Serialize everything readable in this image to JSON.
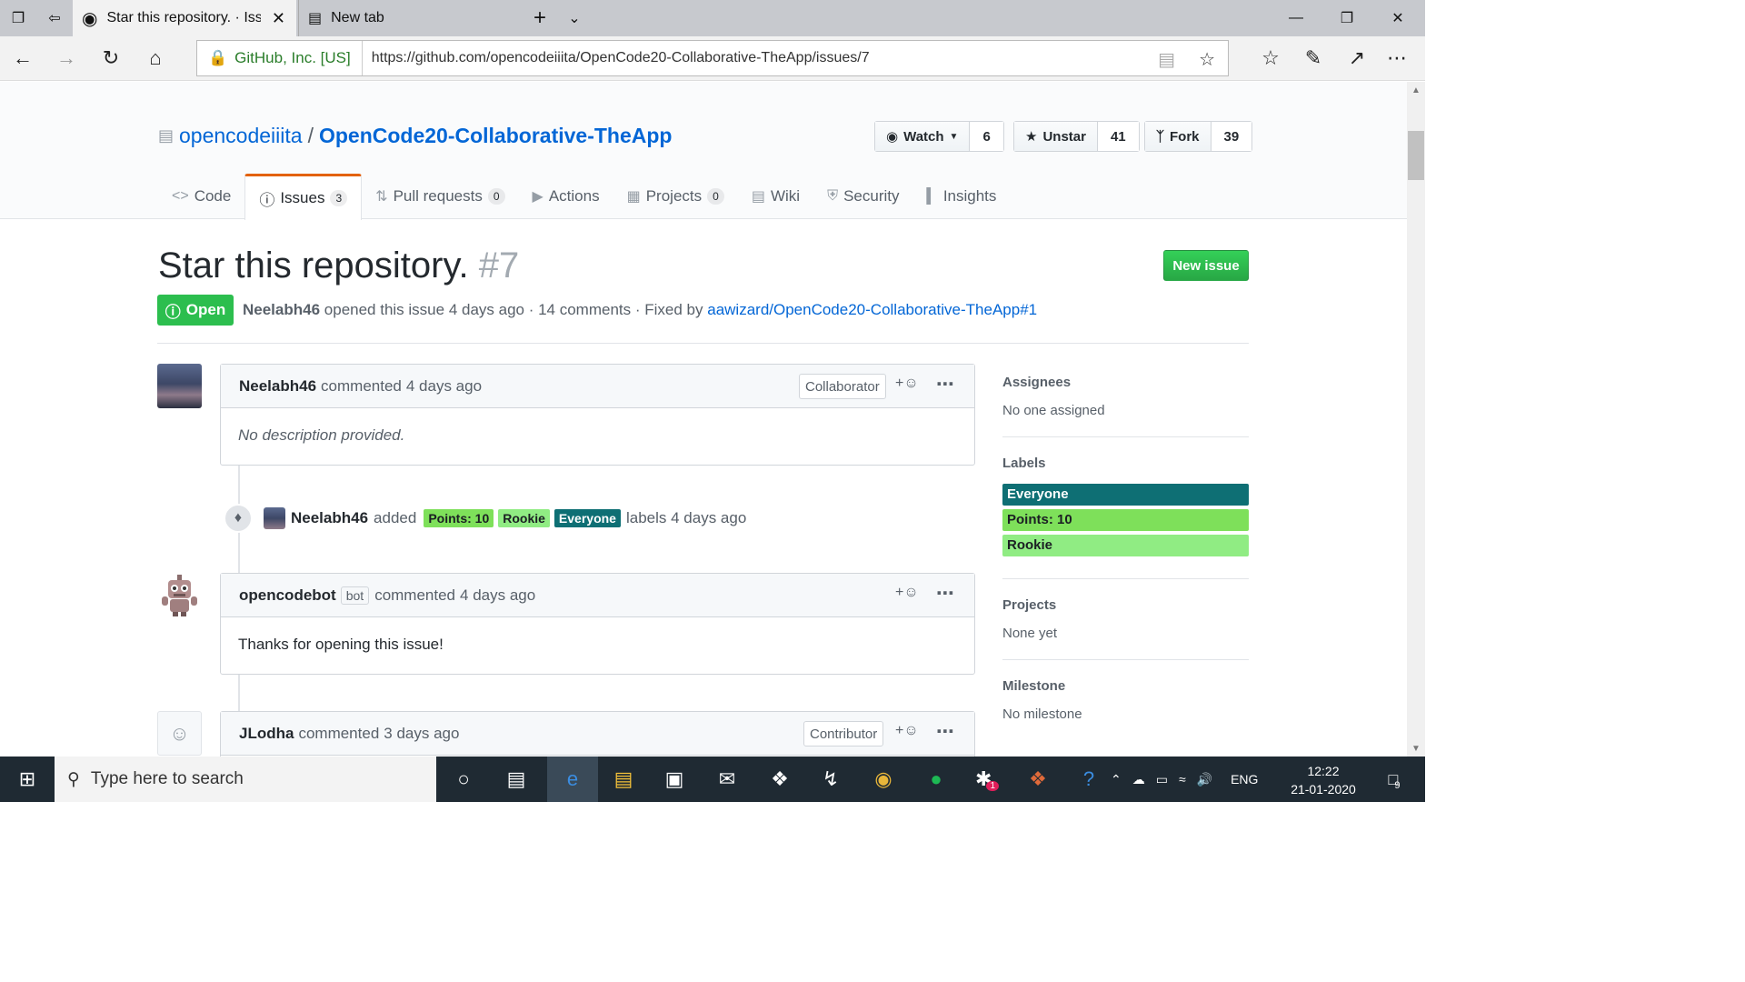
{
  "browser": {
    "active_tab_title": "Star this repository. · Iss",
    "inactive_tab_title": "New tab",
    "security_label": "GitHub, Inc. [US]",
    "url": "https://github.com/opencodeiiita/OpenCode20-Collaborative-TheApp/issues/7"
  },
  "repo": {
    "owner": "opencodeiiita",
    "separator": "/",
    "name": "OpenCode20-Collaborative-TheApp",
    "watch_label": "Watch",
    "watch_count": "6",
    "star_label": "Unstar",
    "star_count": "41",
    "fork_label": "Fork",
    "fork_count": "39"
  },
  "tabs": [
    {
      "label": "Code",
      "icon": "code-icon"
    },
    {
      "label": "Issues",
      "count": "3",
      "icon": "issue-icon"
    },
    {
      "label": "Pull requests",
      "count": "0",
      "icon": "pull-request-icon"
    },
    {
      "label": "Actions",
      "icon": "play-icon"
    },
    {
      "label": "Projects",
      "count": "0",
      "icon": "project-icon"
    },
    {
      "label": "Wiki",
      "icon": "book-icon"
    },
    {
      "label": "Security",
      "icon": "shield-icon"
    },
    {
      "label": "Insights",
      "icon": "graph-icon"
    }
  ],
  "issue": {
    "title": "Star this repository.",
    "number": "#7",
    "new_issue_label": "New issue",
    "state": "Open",
    "author": "Neelabh46",
    "meta_text": "opened this issue 4 days ago · 14 comments · Fixed by",
    "fixed_by_link": "aawizard/OpenCode20-Collaborative-TheApp#1"
  },
  "comments": [
    {
      "author": "Neelabh46",
      "action": "commented",
      "ago": "4 days ago",
      "role": "Collaborator",
      "body": "No description provided."
    },
    {
      "author": "opencodebot",
      "bot_badge": "bot",
      "action": "commented",
      "ago": "4 days ago",
      "body": "Thanks for opening this issue!"
    },
    {
      "author": "JLodha",
      "action": "commented",
      "ago": "3 days ago",
      "role": "Contributor"
    }
  ],
  "label_event": {
    "actor": "Neelabh46",
    "verb": "added",
    "labels": [
      "Points: 10",
      "Rookie",
      "Everyone"
    ],
    "suffix": "labels 4 days ago"
  },
  "sidebar": {
    "assignees_heading": "Assignees",
    "assignees_value": "No one assigned",
    "labels_heading": "Labels",
    "labels": [
      {
        "name": "Everyone",
        "color": "#0e6f74"
      },
      {
        "name": "Points: 10",
        "color": "#7ee05a"
      },
      {
        "name": "Rookie",
        "color": "#90ec83"
      }
    ],
    "projects_heading": "Projects",
    "projects_value": "None yet",
    "milestone_heading": "Milestone",
    "milestone_value": "No milestone"
  },
  "taskbar": {
    "search_placeholder": "Type here to search",
    "language": "ENG",
    "time": "12:22",
    "date": "21-01-2020",
    "notification_count": "9",
    "slack_badge": "1"
  },
  "colors": {
    "link": "#0366d6",
    "open_green": "#2cbe4e",
    "tab_accent": "#e36209"
  }
}
